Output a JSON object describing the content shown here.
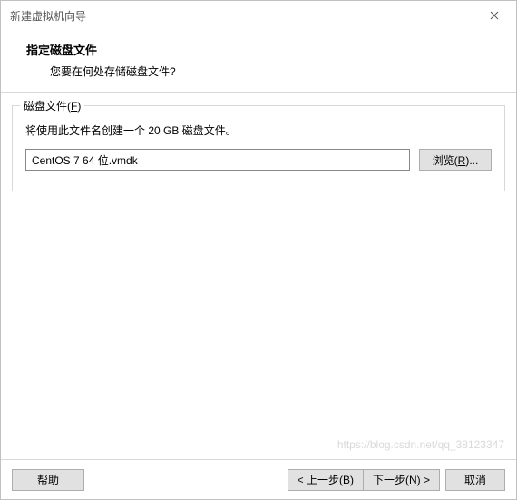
{
  "titlebar": {
    "title": "新建虚拟机向导"
  },
  "header": {
    "title": "指定磁盘文件",
    "subtitle": "您要在何处存储磁盘文件?"
  },
  "fieldset": {
    "legend_prefix": "磁盘文件(",
    "legend_mnemonic": "F",
    "legend_suffix": ")",
    "description": "将使用此文件名创建一个 20 GB 磁盘文件。",
    "filepath_value": "CentOS 7 64 位.vmdk",
    "browse_prefix": "浏览(",
    "browse_mnemonic": "R",
    "browse_suffix": ")..."
  },
  "footer": {
    "help": "帮助",
    "back_prefix": "< 上一步(",
    "back_mnemonic": "B",
    "back_suffix": ")",
    "next_prefix": "下一步(",
    "next_mnemonic": "N",
    "next_suffix": ") >",
    "cancel": "取消"
  },
  "watermark": "https://blog.csdn.net/qq_38123347"
}
